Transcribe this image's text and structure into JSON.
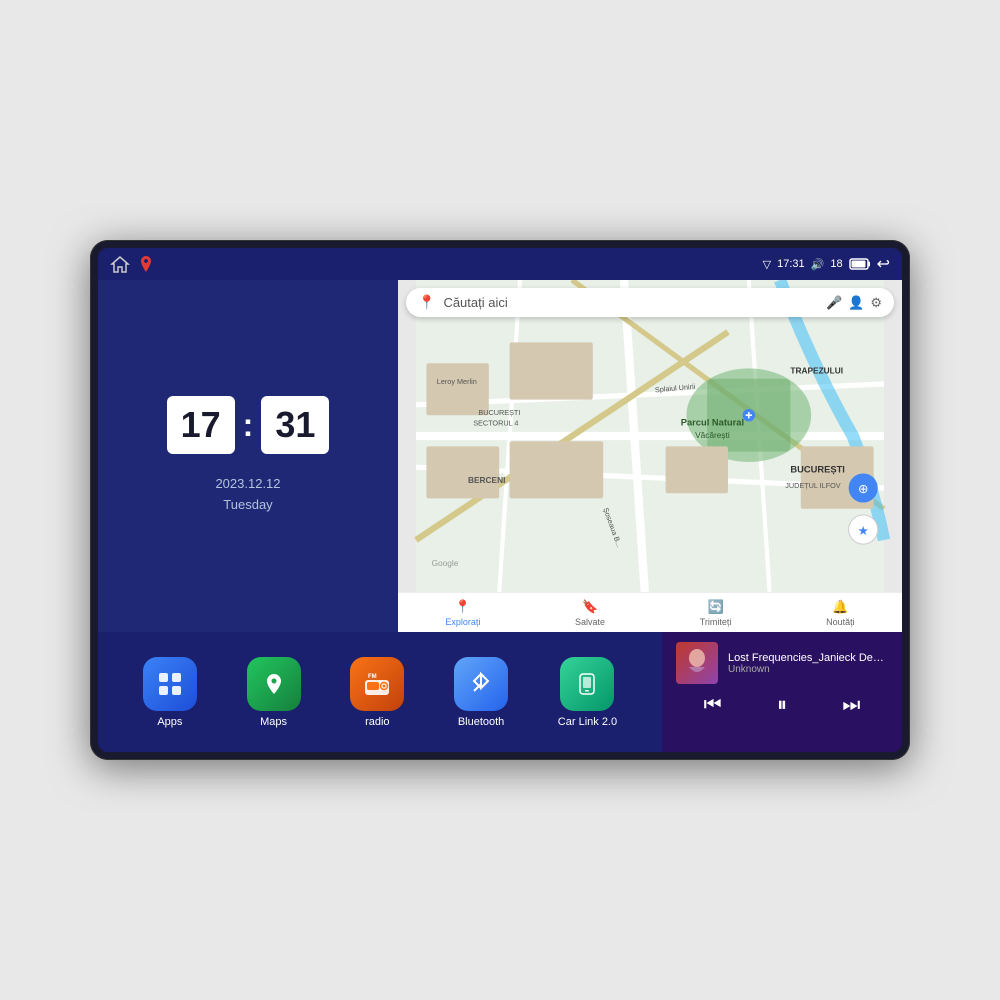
{
  "device": {
    "status_bar": {
      "time": "17:31",
      "signal": "18",
      "nav_icon": "◁"
    },
    "clock": {
      "hours": "17",
      "minutes": "31",
      "date": "2023.12.12",
      "day": "Tuesday"
    },
    "map": {
      "search_placeholder": "Căutați aici",
      "nav_items": [
        {
          "label": "Explorați",
          "icon": "📍",
          "active": true
        },
        {
          "label": "Salvate",
          "icon": "🔖",
          "active": false
        },
        {
          "label": "Trimiteți",
          "icon": "🔄",
          "active": false
        },
        {
          "label": "Noutăți",
          "icon": "🔔",
          "active": false
        }
      ]
    },
    "apps": [
      {
        "id": "apps",
        "label": "Apps",
        "icon": "⊞",
        "bg": "apps-bg"
      },
      {
        "id": "maps",
        "label": "Maps",
        "icon": "📍",
        "bg": "maps-bg"
      },
      {
        "id": "radio",
        "label": "radio",
        "icon": "📻",
        "bg": "radio-bg"
      },
      {
        "id": "bluetooth",
        "label": "Bluetooth",
        "icon": "⚡",
        "bg": "bluetooth-bg"
      },
      {
        "id": "carlink",
        "label": "Car Link 2.0",
        "icon": "📱",
        "bg": "carlink-bg"
      }
    ],
    "music": {
      "title": "Lost Frequencies_Janieck Devy-...",
      "artist": "Unknown",
      "thumb_emoji": "🎵"
    }
  }
}
